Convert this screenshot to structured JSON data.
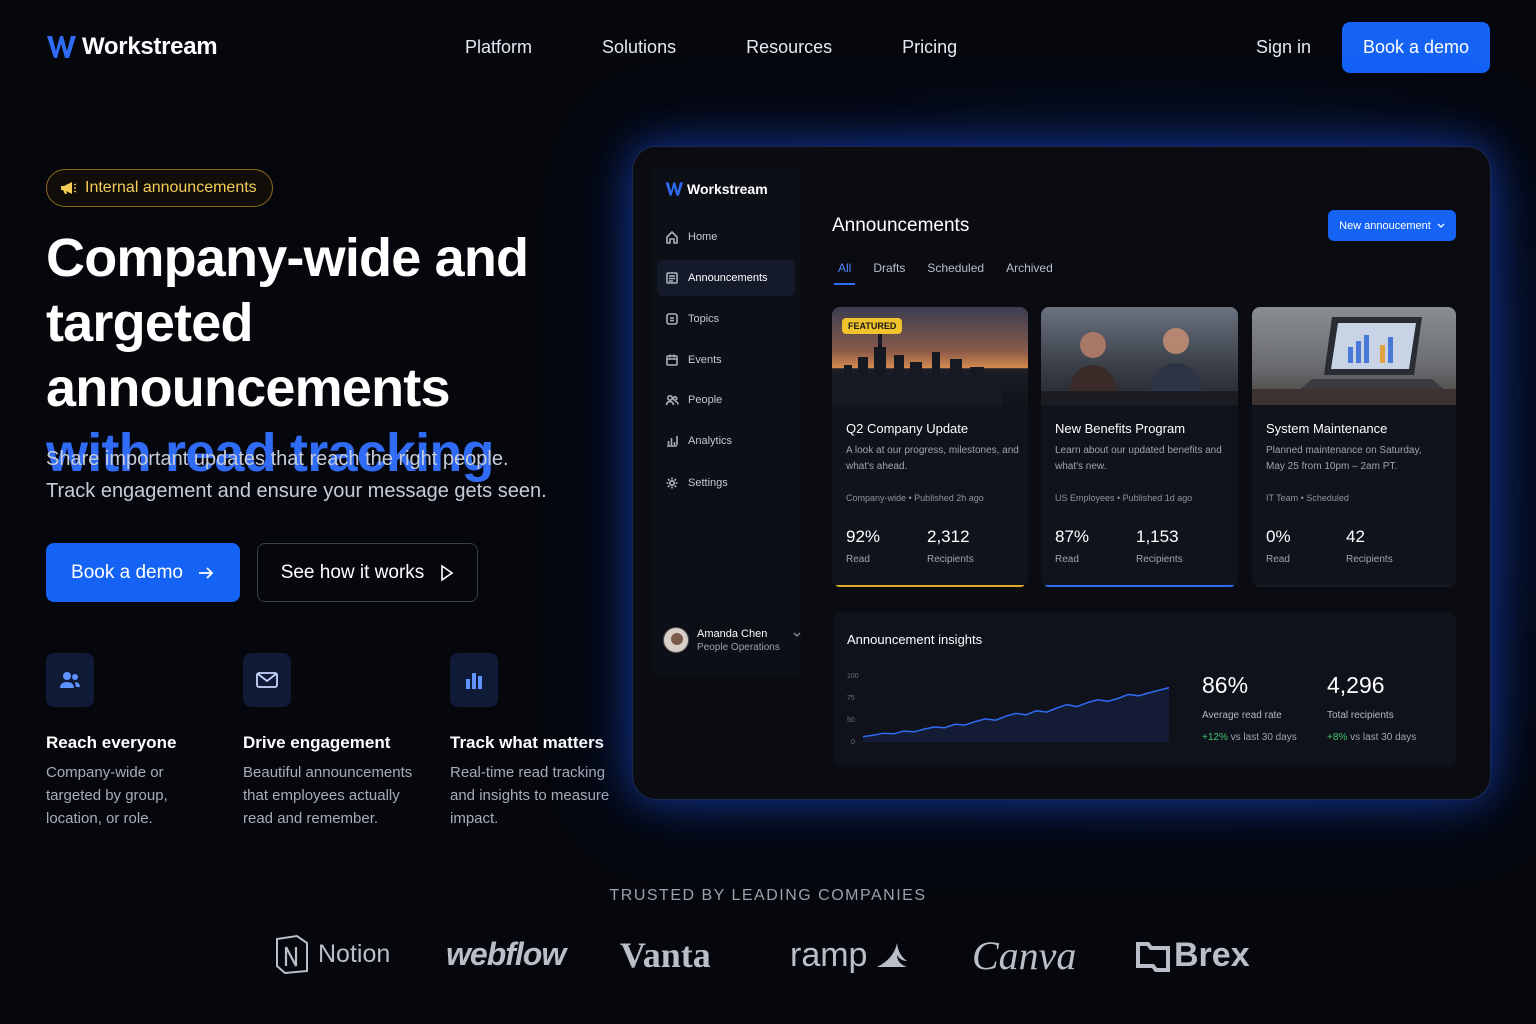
{
  "brand": {
    "name": "Workstream",
    "accent": "#1463f5"
  },
  "nav": {
    "links": [
      "Platform",
      "Solutions",
      "Resources",
      "Pricing"
    ],
    "sign_in": "Sign in",
    "book_demo": "Book a demo"
  },
  "hero": {
    "pill": "Internal announcements",
    "title_line1": "Company-wide and",
    "title_line2": "targeted announcements",
    "title_line3": "with read tracking",
    "subtitle_line1": "Share important updates that reach the right people.",
    "subtitle_line2": "Track engagement and ensure your message gets seen.",
    "primary_cta": "Book a demo",
    "secondary_cta": "See how it works"
  },
  "features": [
    {
      "icon": "users-icon",
      "title": "Reach everyone",
      "desc": "Company-wide or targeted by group, location, or role."
    },
    {
      "icon": "mail-icon",
      "title": "Drive engagement",
      "desc": "Beautiful announcements that employees actually read and remember."
    },
    {
      "icon": "bar-chart-icon",
      "title": "Track what matters",
      "desc": "Real-time read tracking and insights to measure impact."
    }
  ],
  "dashboard": {
    "brand": "Workstream",
    "sidebar": [
      {
        "icon": "home-icon",
        "label": "Home"
      },
      {
        "icon": "announcement-icon",
        "label": "Announcements",
        "active": true
      },
      {
        "icon": "topics-icon",
        "label": "Topics"
      },
      {
        "icon": "calendar-icon",
        "label": "Events"
      },
      {
        "icon": "people-icon",
        "label": "People"
      },
      {
        "icon": "analytics-icon",
        "label": "Analytics"
      },
      {
        "icon": "gear-icon",
        "label": "Settings"
      }
    ],
    "user": {
      "name": "Amanda Chen",
      "role": "People Operations"
    },
    "title": "Announcements",
    "new_button": "New annoucement",
    "tabs": [
      "All",
      "Drafts",
      "Scheduled",
      "Archived"
    ],
    "cards": [
      {
        "badge": "FEATURED",
        "title": "Q2 Company Update",
        "desc": "A look at our progress, milestones, and what's ahead.",
        "meta": "Company-wide  •  Published 2h ago",
        "read": "92%",
        "read_label": "Read",
        "recipients": "2,312",
        "recipients_label": "Recipients",
        "bar_color": "#e0a92a"
      },
      {
        "title": "New Benefits Program",
        "desc": "Learn about our updated benefits and what's new.",
        "meta": "US Employees  •  Published 1d ago",
        "read": "87%",
        "read_label": "Read",
        "recipients": "1,153",
        "recipients_label": "Recipients",
        "bar_color": "#2f6bf5"
      },
      {
        "title": "System Maintenance",
        "desc": "Planned maintenance on Saturday, May 25 from 10pm – 2am PT.",
        "meta": "IT Team  •  Scheduled",
        "read": "0%",
        "read_label": "Read",
        "recipients": "42",
        "recipients_label": "Recipients",
        "bar_color": "#1a1d25"
      }
    ],
    "insights": {
      "title": "Announcement insights",
      "avg_rate": "86%",
      "avg_rate_label": "Average read rate",
      "avg_change": "+12%",
      "avg_change_suffix": " vs last 30 days",
      "total": "4,296",
      "total_label": "Total recipients",
      "total_change": "+8%",
      "total_change_suffix": " vs last 30 days",
      "y_ticks": [
        "100",
        "75",
        "50",
        "0"
      ],
      "line_color": "#2f6bf5",
      "series": [
        8,
        10,
        13,
        12,
        16,
        15,
        19,
        22,
        21,
        26,
        25,
        30,
        34,
        32,
        38,
        42,
        40,
        46,
        44,
        50,
        55,
        52,
        58,
        62,
        60,
        64,
        70,
        68,
        72,
        76,
        80
      ]
    }
  },
  "trusted": {
    "heading": "TRUSTED BY LEADING COMPANIES",
    "logos": [
      "Notion",
      "webflow",
      "Vanta",
      "ramp",
      "Canva",
      "Brex"
    ]
  }
}
